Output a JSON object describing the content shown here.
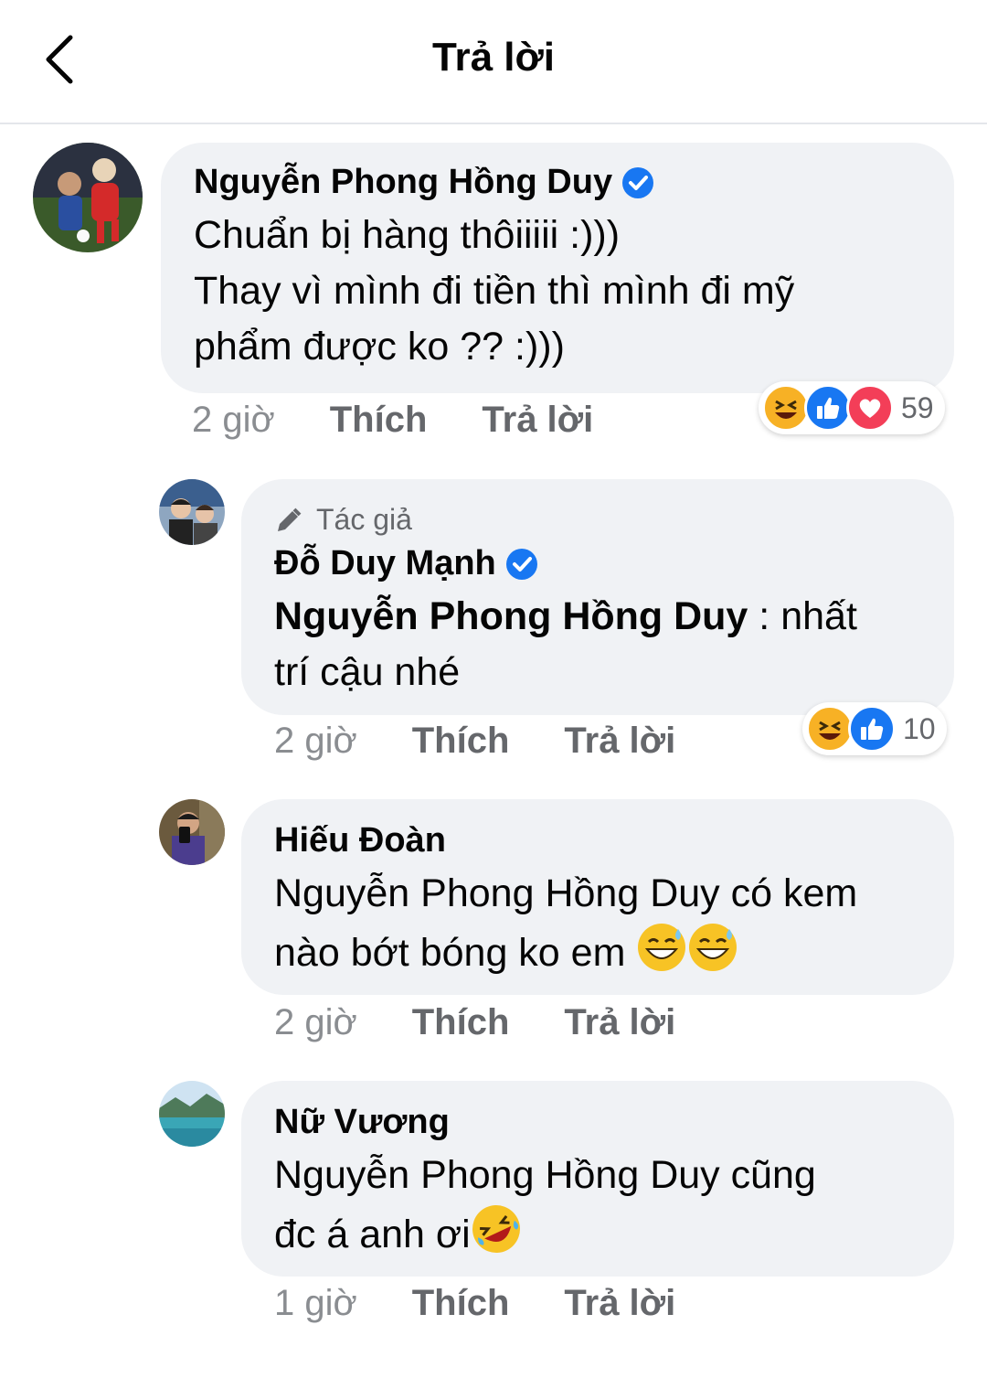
{
  "header": {
    "title": "Trả lời"
  },
  "comments": [
    {
      "author": "Nguyễn Phong Hồng Duy",
      "verified": true,
      "lines": [
        "Chuẩn bị hàng thôiiiii :)))",
        "Thay vì mình đi tiền thì mình đi mỹ",
        "phẩm được ko ?? :)))"
      ],
      "time": "2 giờ",
      "like_label": "Thích",
      "reply_label": "Trả lời",
      "reactions": {
        "icons": [
          "haha",
          "like",
          "love"
        ],
        "count": "59"
      }
    },
    {
      "badge": "Tác giả",
      "author": "Đỗ Duy Mạnh",
      "verified": true,
      "mention": "Nguyễn Phong Hồng Duy",
      "line1_rest": " : nhất",
      "line2": "trí cậu nhé",
      "time": "2 giờ",
      "like_label": "Thích",
      "reply_label": "Trả lời",
      "reactions": {
        "icons": [
          "haha",
          "like"
        ],
        "count": "10"
      }
    },
    {
      "author": "Hiếu Đoàn",
      "line1": "Nguyễn Phong Hồng Duy có kem",
      "line2": "nào bớt bóng ko em ",
      "emojis": [
        "sweat-smile",
        "sweat-smile"
      ],
      "time": "2 giờ",
      "like_label": "Thích",
      "reply_label": "Trả lời"
    },
    {
      "author": "Nữ Vương",
      "line1": "Nguyễn Phong Hồng Duy cũng",
      "line2": "đc á anh ơi",
      "emojis": [
        "rofl"
      ],
      "time": "1 giờ",
      "like_label": "Thích",
      "reply_label": "Trả lời"
    }
  ],
  "colors": {
    "verified": "#1877f2",
    "bubble": "#f0f2f5",
    "like": "#1877f2",
    "love": "#f33e58",
    "haha": "#f7b125"
  }
}
